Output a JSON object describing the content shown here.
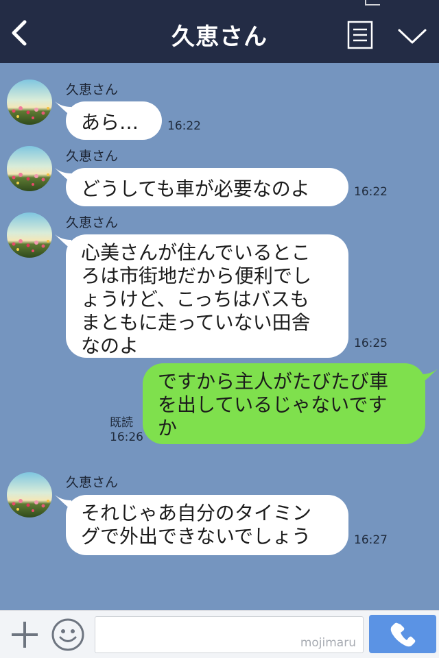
{
  "header": {
    "title": "久恵さん",
    "back_icon": "chevron-left-icon",
    "menu_icon": "menu-icon",
    "collapse_icon": "chevron-down-icon"
  },
  "messages": [
    {
      "direction": "incoming",
      "sender": "久恵さん",
      "text": "あら…",
      "time": "16:22"
    },
    {
      "direction": "incoming",
      "sender": "久恵さん",
      "text": "どうしても車が必要なのよ",
      "time": "16:22"
    },
    {
      "direction": "incoming",
      "sender": "久恵さん",
      "lines": [
        "心美さんが住んでいるとこ",
        "ろは市街地だから便利でし",
        "ょうけど、こっちはバスも",
        "まともに走っていない田舎",
        "なのよ"
      ],
      "time": "16:25"
    },
    {
      "direction": "outgoing",
      "lines": [
        "ですから主人がたびたび車",
        "を出しているじゃないです",
        "か"
      ],
      "read": "既読",
      "time": "16:26"
    },
    {
      "direction": "incoming",
      "sender": "久恵さん",
      "lines": [
        "それじゃあ自分のタイミン",
        "グで外出できないでしょう"
      ],
      "time": "16:27"
    }
  ],
  "footer": {
    "plus_icon": "plus-icon",
    "emoji_icon": "smiley-icon",
    "input_value": "",
    "watermark": "mojimaru",
    "call_icon": "phone-icon"
  },
  "colors": {
    "header_bg": "#232c45",
    "chat_bg": "#7595bf",
    "incoming_bubble": "#ffffff",
    "outgoing_bubble": "#7fe04d",
    "call_button": "#5b93e4"
  }
}
